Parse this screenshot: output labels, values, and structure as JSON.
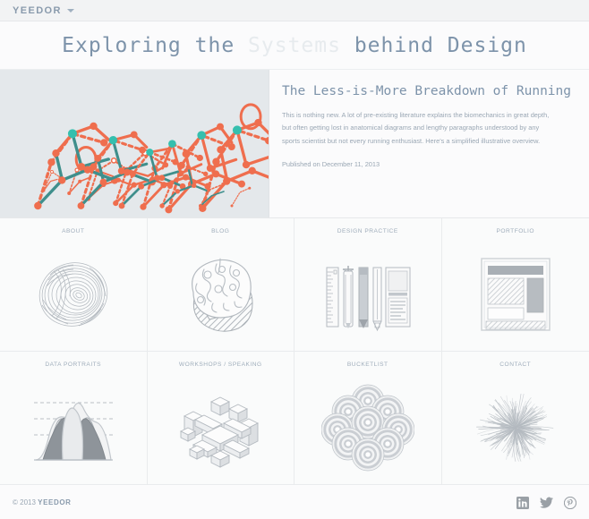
{
  "topbar": {
    "brand": "YEEDOR",
    "caret_icon": "chevron-down-icon"
  },
  "site_title": {
    "part1": "Exploring the",
    "highlight": "Systems",
    "part2": "behind Design"
  },
  "hero": {
    "art_name": "running-figure-motion-study",
    "heading": "The Less-is-More Breakdown of Running",
    "body": "This is nothing new. A lot of pre-existing literature explains the biomechanics in great depth, but often getting lost in anatomical diagrams and lengthy paragraphs understood by any sports scientist but not every running enthusiast. Here's a simplified illustrative overview.",
    "published": "Published on December 11, 2013"
  },
  "grid": {
    "cells": [
      {
        "label": "ABOUT",
        "icon": "fingerprint-sphere-icon"
      },
      {
        "label": "BLOG",
        "icon": "brain-icon"
      },
      {
        "label": "DESIGN PRACTICE",
        "icon": "drafting-tools-icon"
      },
      {
        "label": "PORTFOLIO",
        "icon": "webpage-wireframe-icon"
      },
      {
        "label": "DATA PORTRAITS",
        "icon": "distribution-curves-icon"
      },
      {
        "label": "WORKSHOPS / SPEAKING",
        "icon": "isometric-blocks-icon"
      },
      {
        "label": "BUCKETLIST",
        "icon": "overlapping-circles-icon"
      },
      {
        "label": "CONTACT",
        "icon": "radial-burst-icon"
      }
    ]
  },
  "footer": {
    "copyright_prefix": "© 2013 ",
    "copyright_brand": "YEEDOR",
    "socials": [
      {
        "name": "linkedin-icon",
        "label": "LinkedIn"
      },
      {
        "name": "twitter-icon",
        "label": "Twitter"
      },
      {
        "name": "pinterest-icon",
        "label": "Pinterest"
      }
    ]
  },
  "colors": {
    "accent_blue": "#7d93aa",
    "muted_text": "#9aa7b4",
    "hero_bg": "#e4e8eb",
    "figure_coral": "#ef6e4e",
    "figure_teal": "#35bfae",
    "line_gray": "#b9bfc5"
  }
}
